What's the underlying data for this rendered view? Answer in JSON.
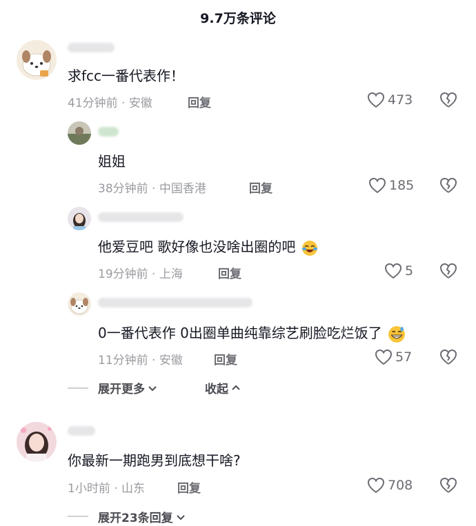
{
  "header": {
    "title": "9.7万条评论"
  },
  "comments": [
    {
      "text": "求fcc一番代表作！",
      "time": "41分钟前",
      "location": "安徽",
      "reply_label": "回复",
      "likes": "473",
      "replies": [
        {
          "text": "姐姐",
          "time": "38分钟前",
          "location": "中国香港",
          "reply_label": "回复",
          "likes": "185"
        },
        {
          "text": "他爱豆吧 歌好像也没啥出圈的吧",
          "time": "19分钟前",
          "location": "上海",
          "reply_label": "回复",
          "likes": "5"
        },
        {
          "text": "0一番代表作 0出圈单曲纯靠综艺刷脸吃烂饭了",
          "time": "11分钟前",
          "location": "安徽",
          "reply_label": "回复",
          "likes": "57"
        }
      ],
      "expand_more_label": "展开更多",
      "collapse_label": "收起"
    },
    {
      "text": "你最新一期跑男到底想干啥?",
      "time": "1小时前",
      "location": "山东",
      "reply_label": "回复",
      "likes": "708",
      "expand_replies_label": "展开23条回复"
    }
  ],
  "meta_separator": " · ",
  "colors": {
    "text": "#161823",
    "meta": "#9a9ba0",
    "accent_gray": "#6b6c72"
  }
}
